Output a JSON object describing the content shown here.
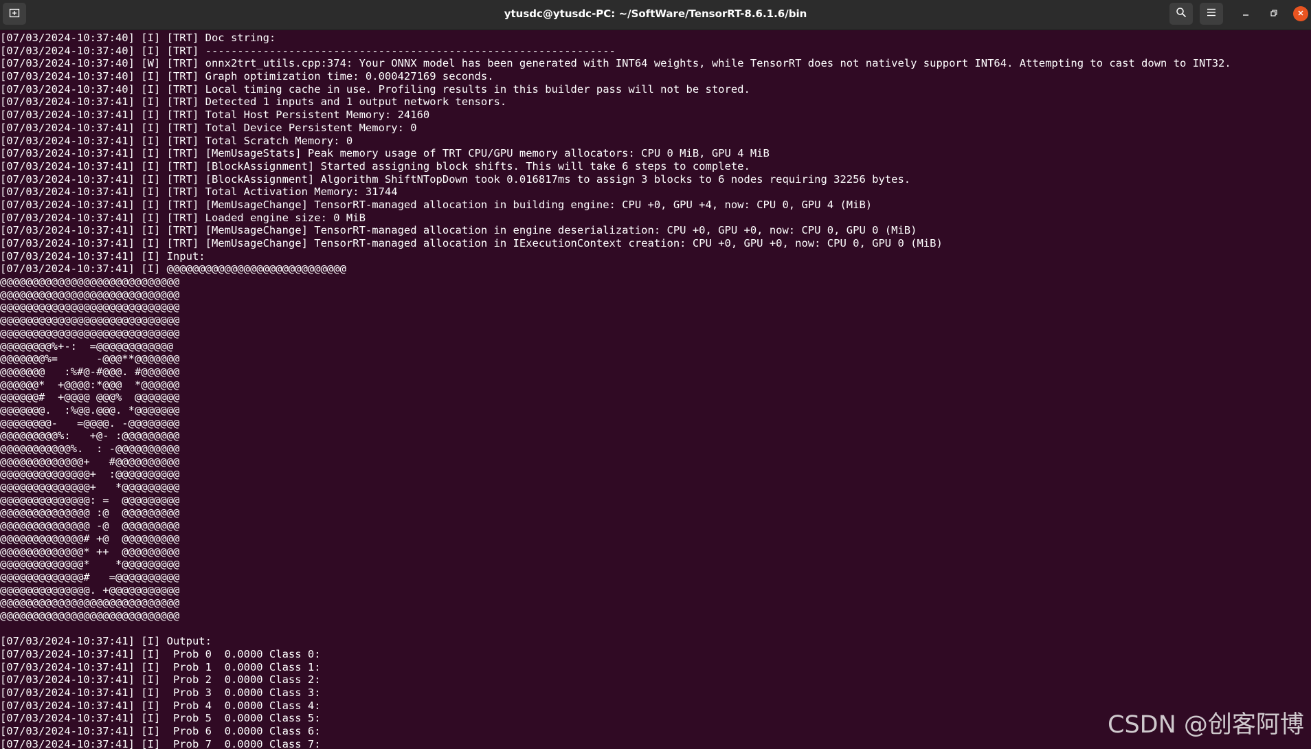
{
  "window": {
    "title": "ytusdc@ytusdc-PC: ~/SoftWare/TensorRT-8.6.1.6/bin",
    "accent_close": "#e95420",
    "terminal_bg": "#300a24",
    "titlebar_bg": "#2c2c2c"
  },
  "icons": {
    "new_tab": "new-tab-icon",
    "search": "search-icon",
    "menu": "hamburger-menu-icon",
    "minimize": "minimize-icon",
    "maximize": "maximize-icon",
    "close": "close-icon"
  },
  "terminal": {
    "lines": [
      "[07/03/2024-10:37:40] [I] [TRT] Doc string:",
      "[07/03/2024-10:37:40] [I] [TRT] ----------------------------------------------------------------",
      "[07/03/2024-10:37:40] [W] [TRT] onnx2trt_utils.cpp:374: Your ONNX model has been generated with INT64 weights, while TensorRT does not natively support INT64. Attempting to cast down to INT32.",
      "[07/03/2024-10:37:40] [I] [TRT] Graph optimization time: 0.000427169 seconds.",
      "[07/03/2024-10:37:40] [I] [TRT] Local timing cache in use. Profiling results in this builder pass will not be stored.",
      "[07/03/2024-10:37:41] [I] [TRT] Detected 1 inputs and 1 output network tensors.",
      "[07/03/2024-10:37:41] [I] [TRT] Total Host Persistent Memory: 24160",
      "[07/03/2024-10:37:41] [I] [TRT] Total Device Persistent Memory: 0",
      "[07/03/2024-10:37:41] [I] [TRT] Total Scratch Memory: 0",
      "[07/03/2024-10:37:41] [I] [TRT] [MemUsageStats] Peak memory usage of TRT CPU/GPU memory allocators: CPU 0 MiB, GPU 4 MiB",
      "[07/03/2024-10:37:41] [I] [TRT] [BlockAssignment] Started assigning block shifts. This will take 6 steps to complete.",
      "[07/03/2024-10:37:41] [I] [TRT] [BlockAssignment] Algorithm ShiftNTopDown took 0.016817ms to assign 3 blocks to 6 nodes requiring 32256 bytes.",
      "[07/03/2024-10:37:41] [I] [TRT] Total Activation Memory: 31744",
      "[07/03/2024-10:37:41] [I] [TRT] [MemUsageChange] TensorRT-managed allocation in building engine: CPU +0, GPU +4, now: CPU 0, GPU 4 (MiB)",
      "[07/03/2024-10:37:41] [I] [TRT] Loaded engine size: 0 MiB",
      "[07/03/2024-10:37:41] [I] [TRT] [MemUsageChange] TensorRT-managed allocation in engine deserialization: CPU +0, GPU +0, now: CPU 0, GPU 0 (MiB)",
      "[07/03/2024-10:37:41] [I] [TRT] [MemUsageChange] TensorRT-managed allocation in IExecutionContext creation: CPU +0, GPU +0, now: CPU 0, GPU 0 (MiB)",
      "[07/03/2024-10:37:41] [I] Input:",
      "[07/03/2024-10:37:41] [I] @@@@@@@@@@@@@@@@@@@@@@@@@@@@",
      "@@@@@@@@@@@@@@@@@@@@@@@@@@@@",
      "@@@@@@@@@@@@@@@@@@@@@@@@@@@@",
      "@@@@@@@@@@@@@@@@@@@@@@@@@@@@",
      "@@@@@@@@@@@@@@@@@@@@@@@@@@@@",
      "@@@@@@@@@@@@@@@@@@@@@@@@@@@@",
      "@@@@@@@@%+-:  =@@@@@@@@@@@@",
      "@@@@@@@%=      -@@@**@@@@@@@",
      "@@@@@@@   :%#@-#@@@. #@@@@@@",
      "@@@@@@*  +@@@@:*@@@  *@@@@@@",
      "@@@@@@#  +@@@@ @@@%  @@@@@@@",
      "@@@@@@@.  :%@@.@@@. *@@@@@@@",
      "@@@@@@@@-   =@@@@. -@@@@@@@@",
      "@@@@@@@@@%:   +@- :@@@@@@@@@",
      "@@@@@@@@@@@%.  : -@@@@@@@@@@",
      "@@@@@@@@@@@@@+   #@@@@@@@@@@",
      "@@@@@@@@@@@@@@+  :@@@@@@@@@@",
      "@@@@@@@@@@@@@@+   *@@@@@@@@@",
      "@@@@@@@@@@@@@@: =  @@@@@@@@@",
      "@@@@@@@@@@@@@@ :@  @@@@@@@@@",
      "@@@@@@@@@@@@@@ -@  @@@@@@@@@",
      "@@@@@@@@@@@@@# +@  @@@@@@@@@",
      "@@@@@@@@@@@@@* ++  @@@@@@@@@",
      "@@@@@@@@@@@@@*    *@@@@@@@@@",
      "@@@@@@@@@@@@@#   =@@@@@@@@@@",
      "@@@@@@@@@@@@@@. +@@@@@@@@@@@",
      "@@@@@@@@@@@@@@@@@@@@@@@@@@@@",
      "@@@@@@@@@@@@@@@@@@@@@@@@@@@@",
      "",
      "[07/03/2024-10:37:41] [I] Output:",
      "[07/03/2024-10:37:41] [I]  Prob 0  0.0000 Class 0:",
      "[07/03/2024-10:37:41] [I]  Prob 1  0.0000 Class 1:",
      "[07/03/2024-10:37:41] [I]  Prob 2  0.0000 Class 2:",
      "[07/03/2024-10:37:41] [I]  Prob 3  0.0000 Class 3:",
      "[07/03/2024-10:37:41] [I]  Prob 4  0.0000 Class 4:",
      "[07/03/2024-10:37:41] [I]  Prob 5  0.0000 Class 5:",
      "[07/03/2024-10:37:41] [I]  Prob 6  0.0000 Class 6:",
      "[07/03/2024-10:37:41] [I]  Prob 7  0.0000 Class 7:"
    ]
  },
  "watermark": "CSDN @创客阿博"
}
